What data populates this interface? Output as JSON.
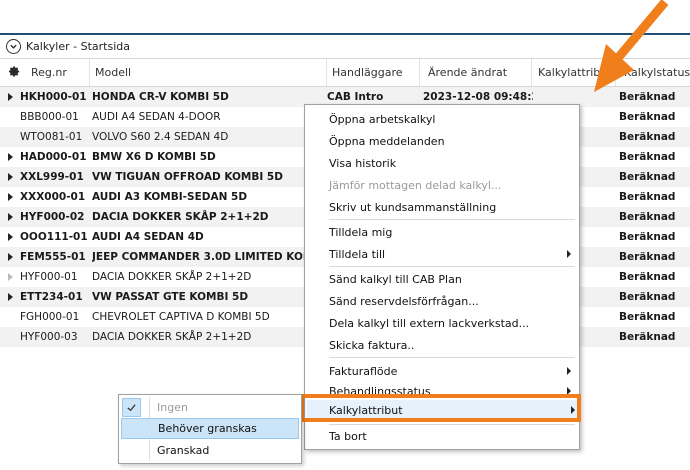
{
  "window": {
    "title": "Kalkyler - Startsida"
  },
  "columns": [
    {
      "key": "reg",
      "label": "Reg.nr"
    },
    {
      "key": "model",
      "label": "Modell"
    },
    {
      "key": "handler",
      "label": "Handläggare"
    },
    {
      "key": "changed",
      "label": "Ärende ändrat"
    },
    {
      "key": "attr",
      "label": "Kalkylattribut"
    },
    {
      "key": "status",
      "label": "Kalkylstatus"
    }
  ],
  "rows": [
    {
      "reg": "HKH000-01",
      "model": "HONDA CR-V KOMBI 5D",
      "handler": "CAB Intro",
      "changed": "2023-12-08 09:48:29",
      "status": "Beräknad",
      "bold": true,
      "expander": "solid"
    },
    {
      "reg": "BBB000-01",
      "model": "AUDI A4 SEDAN 4-DOOR",
      "handler": "",
      "changed": "",
      "status": "Beräknad",
      "bold": false,
      "expander": "none"
    },
    {
      "reg": "WTO081-01",
      "model": "VOLVO S60 2.4 SEDAN 4D",
      "handler": "",
      "changed": "",
      "status": "Beräknad",
      "bold": false,
      "expander": "none"
    },
    {
      "reg": "HAD000-01",
      "model": "BMW X6 D KOMBI 5D",
      "handler": "",
      "changed": "",
      "status": "Beräknad",
      "bold": true,
      "expander": "solid"
    },
    {
      "reg": "XXL999-01",
      "model": "VW TIGUAN OFFROAD KOMBI 5D",
      "handler": "",
      "changed": "",
      "status": "Beräknad",
      "bold": true,
      "expander": "solid"
    },
    {
      "reg": "XXX000-01",
      "model": "AUDI A3 KOMBI-SEDAN 5D",
      "handler": "",
      "changed": "",
      "status": "Beräknad",
      "bold": true,
      "expander": "solid"
    },
    {
      "reg": "HYF000-02",
      "model": "DACIA DOKKER SKÅP 2+1+2D",
      "handler": "",
      "changed": "",
      "status": "Beräknad",
      "bold": true,
      "expander": "solid"
    },
    {
      "reg": "OOO111-01",
      "model": "AUDI A4 SEDAN 4D",
      "handler": "",
      "changed": "",
      "status": "Beräknad",
      "bold": true,
      "expander": "solid"
    },
    {
      "reg": "FEM555-01",
      "model": "JEEP COMMANDER 3.0D LIMITED KOMB",
      "handler": "",
      "changed": "",
      "status": "Beräknad",
      "bold": true,
      "expander": "solid"
    },
    {
      "reg": "HYF000-01",
      "model": "DACIA DOKKER SKÅP 2+1+2D",
      "handler": "",
      "changed": "",
      "status": "Beräknad",
      "bold": false,
      "expander": "faint"
    },
    {
      "reg": "ETT234-01",
      "model": "VW PASSAT GTE KOMBI 5D",
      "handler": "",
      "changed": "",
      "status": "Beräknad",
      "bold": true,
      "expander": "solid"
    },
    {
      "reg": "FGH000-01",
      "model": "CHEVROLET CAPTIVA D KOMBI 5D",
      "handler": "",
      "changed": "",
      "status": "Beräknad",
      "bold": false,
      "expander": "none"
    },
    {
      "reg": "HYF000-03",
      "model": "DACIA DOKKER SKÅP 2+1+2D",
      "handler": "",
      "changed": "",
      "status": "Beräknad",
      "bold": false,
      "expander": "none"
    }
  ],
  "context_menu": {
    "open_calc": "Öppna arbetskalkyl",
    "open_messages": "Öppna meddelanden",
    "show_history": "Visa historik",
    "compare_shared": "Jämför mottagen delad kalkyl...",
    "print_summary": "Skriv ut kundsammanställning",
    "assign_me": "Tilldela mig",
    "assign_to": "Tilldela till",
    "send_cab_plan": "Sänd kalkyl till CAB Plan",
    "send_parts_request": "Sänd reservdelsförfrågan...",
    "share_paint_shop": "Dela kalkyl till extern lackverkstad...",
    "send_invoice": "Skicka faktura..",
    "invoice_flow": "Fakturaflöde",
    "handling_status": "Behandlingsstatus",
    "calc_attribute": "Kalkylattribut",
    "delete": "Ta bort"
  },
  "submenu": {
    "none": "Ingen",
    "needs_review": "Behöver granskas",
    "reviewed": "Granskad"
  },
  "colors": {
    "accent_orange": "#f07f1b",
    "header_bar": "#1f4e79",
    "hover_blue": "#cce4f7"
  }
}
